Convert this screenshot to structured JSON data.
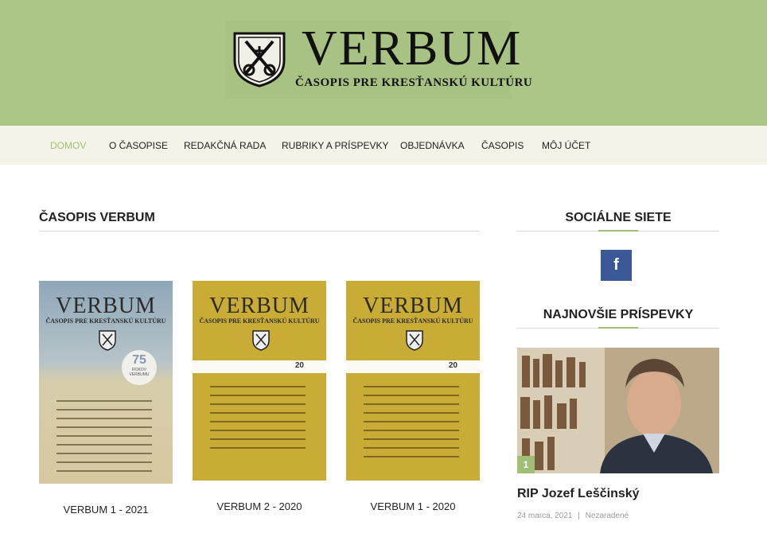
{
  "brand": {
    "title": "VERBUM",
    "subtitle": "ČASOPIS PRE KRESŤANSKÚ KULTÚRU",
    "bg": "#abc687"
  },
  "nav": {
    "items": [
      {
        "label": "DOMOV",
        "active": true
      },
      {
        "label": "O ČASOPISE"
      },
      {
        "label": "REDAKČNÁ RADA"
      },
      {
        "label": "RUBRIKY A PRÍSPEVKY"
      },
      {
        "label": "OBJEDNÁVKA"
      },
      {
        "label": "ČASOPIS"
      },
      {
        "label": "MÔJ ÚČET"
      }
    ]
  },
  "main": {
    "title": "ČASOPIS VERBUM",
    "covers": [
      {
        "caption": "VERBUM 1 - 2021",
        "cover_title": "VERBUM",
        "cover_subtitle": "ČASOPIS PRE KRESŤANSKÚ KULTÚRU",
        "anniversary": "75",
        "anniversary_text": "ROKOV VERBUMU",
        "style": "blue-sand"
      },
      {
        "caption": "VERBUM 2 - 2020",
        "cover_title": "VERBUM",
        "cover_subtitle": "ČASOPIS PRE KRESŤANSKÚ KULTÚRU",
        "badge": "20",
        "style": "gold"
      },
      {
        "caption": "VERBUM 1 - 2020",
        "cover_title": "VERBUM",
        "cover_subtitle": "ČASOPIS PRE KRESŤANSKÚ KULTÚRU",
        "badge": "20",
        "style": "gold"
      }
    ]
  },
  "sidebar": {
    "social_title": "SOCIÁLNE SIETE",
    "facebook_icon": "f",
    "latest_title": "NAJNOVŠIE PRÍSPEVKY",
    "post": {
      "number": "1",
      "title": "RIP Jozef Leščinský",
      "date": "24 marca, 2021",
      "separator": "|",
      "category": "Nezaradené"
    }
  },
  "colors": {
    "accent": "#a0bf76",
    "nav_bg": "#f3f4e7",
    "facebook": "#3b5897",
    "gold_cover": "#c9ac35"
  }
}
